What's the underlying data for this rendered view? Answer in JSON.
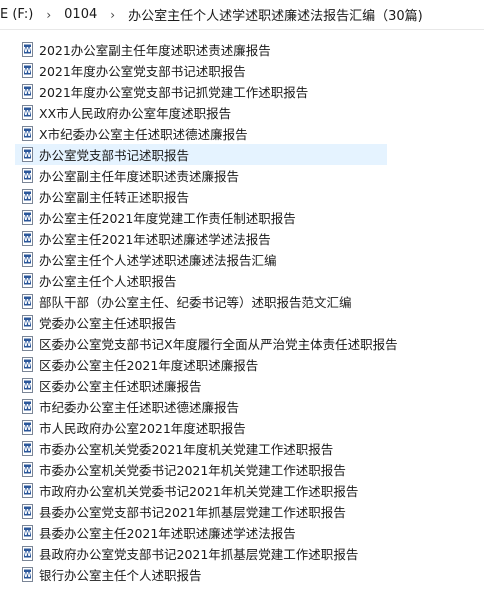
{
  "breadcrumb": [
    "E (F:)",
    "0104",
    "办公室主任个人述学述职述廉述法报告汇编（30篇)"
  ],
  "breadcrumb_separator": "›",
  "icon": "word-document-icon",
  "selected_index": 5,
  "files": [
    "2021办公室副主任年度述职述责述廉报告",
    "2021年度办公室党支部书记述职报告",
    "2021年度办公室党支部书记抓党建工作述职报告",
    "XX市人民政府办公室年度述职报告",
    "X市纪委办公室主任述职述德述廉报告",
    "办公室党支部书记述职报告",
    "办公室副主任年度述职述责述廉报告",
    "办公室副主任转正述职报告",
    "办公室主任2021年度党建工作责任制述职报告",
    "办公室主任2021年述职述廉述学述法报告",
    "办公室主任个人述学述职述廉述法报告汇编",
    "办公室主任个人述职报告",
    "部队干部（办公室主任、纪委书记等）述职报告范文汇编",
    "党委办公室主任述职报告",
    "区委办公室党支部书记X年度履行全面从严治党主体责任述职报告",
    "区委办公室主任2021年度述职述廉报告",
    "区委办公室主任述职述廉报告",
    "市纪委办公室主任述职述德述廉报告",
    "市人民政府办公室2021年度述职报告",
    "市委办公室机关党委2021年度机关党建工作述职报告",
    "市委办公室机关党委书记2021年机关党建工作述职报告",
    "市政府办公室机关党委书记2021年机关党建工作述职报告",
    "县委办公室党支部书记2021年抓基层党建工作述职报告",
    "县委办公室主任2021年述职述廉述学述法报告",
    "县政府办公室党支部书记2021年抓基层党建工作述职报告",
    "银行办公室主任个人述职报告"
  ]
}
